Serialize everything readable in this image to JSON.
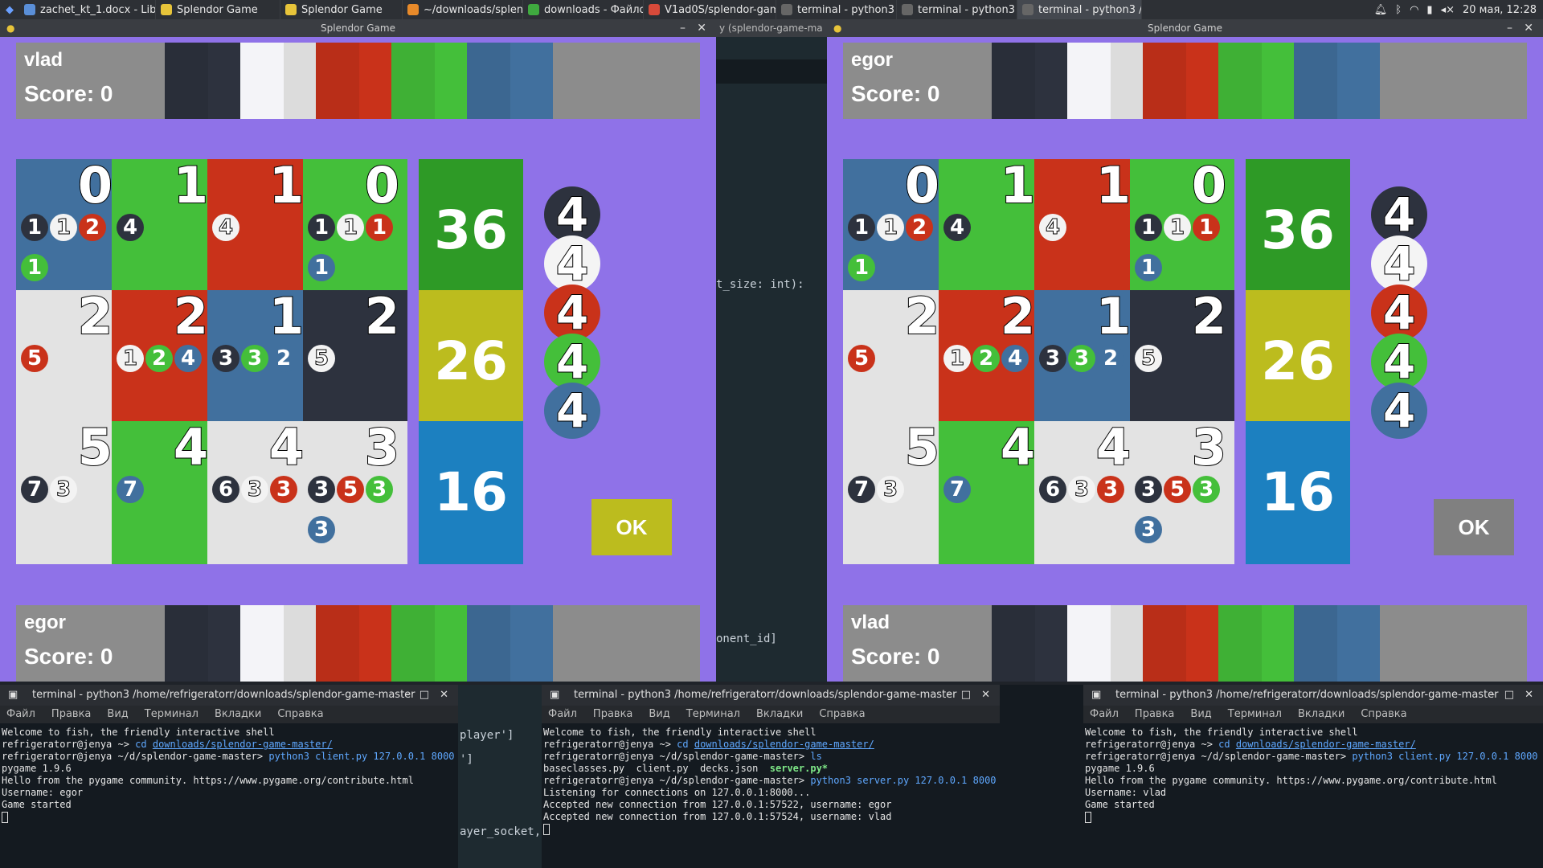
{
  "taskbar": {
    "tasks": [
      "zachet_kt_1.docx - LibreO...",
      "Splendor Game",
      "Splendor Game",
      "~/downloads/splendor-ga...",
      "downloads - Файловый м...",
      "V1ad0S/splendor-game - ...",
      "terminal - python3 /home/...",
      "terminal - python3 /home/...",
      "terminal - python3 /home/..."
    ],
    "clock": "20 мая, 12:28"
  },
  "left_window": {
    "title": "Splendor Game",
    "top_player": {
      "name": "vlad",
      "score": "Score: 0"
    },
    "bottom_player": {
      "name": "egor",
      "score": "Score: 0"
    },
    "ok_label": "OK",
    "ok_color": "#bcbc1e"
  },
  "right_window": {
    "title": "Splendor Game",
    "top_player": {
      "name": "egor",
      "score": "Score: 0"
    },
    "bottom_player": {
      "name": "vlad",
      "score": "Score: 0"
    },
    "ok_label": "OK",
    "ok_color": "#808080"
  },
  "board": {
    "cards": [
      {
        "color": "blue",
        "points": "0",
        "cost": [
          {
            "gem": "black",
            "n": "1"
          },
          {
            "gem": "white",
            "n": "1"
          },
          {
            "gem": "red",
            "n": "2"
          },
          {
            "gem": "green",
            "n": "1"
          }
        ]
      },
      {
        "color": "green",
        "points": "1",
        "cost": [
          {
            "gem": "black",
            "n": "4"
          }
        ]
      },
      {
        "color": "red",
        "points": "1",
        "cost": [
          {
            "gem": "white",
            "n": "4"
          }
        ]
      },
      {
        "color": "green",
        "points": "0",
        "cost": [
          {
            "gem": "black",
            "n": "1"
          },
          {
            "gem": "white",
            "n": "1"
          },
          {
            "gem": "red",
            "n": "1"
          },
          {
            "gem": "blue",
            "n": "1"
          }
        ]
      },
      {
        "color": "white",
        "points": "2",
        "cost": [
          {
            "gem": "red",
            "n": "5"
          }
        ]
      },
      {
        "color": "red",
        "points": "2",
        "cost": [
          {
            "gem": "white",
            "n": "1"
          },
          {
            "gem": "green",
            "n": "2"
          },
          {
            "gem": "blue",
            "n": "4"
          }
        ]
      },
      {
        "color": "blue",
        "points": "1",
        "cost": [
          {
            "gem": "black",
            "n": "3"
          },
          {
            "gem": "green",
            "n": "3"
          },
          {
            "gem": "blue",
            "n": "2"
          }
        ]
      },
      {
        "color": "black",
        "points": "2",
        "cost": [
          {
            "gem": "white",
            "n": "5"
          }
        ]
      },
      {
        "color": "white",
        "points": "5",
        "cost": [
          {
            "gem": "black",
            "n": "7"
          },
          {
            "gem": "white",
            "n": "3"
          }
        ]
      },
      {
        "color": "green",
        "points": "4",
        "cost": [
          {
            "gem": "blue",
            "n": "7"
          }
        ]
      },
      {
        "color": "white",
        "points": "4",
        "cost": [
          {
            "gem": "black",
            "n": "6"
          },
          {
            "gem": "white",
            "n": "3"
          },
          {
            "gem": "red",
            "n": "3"
          }
        ]
      },
      {
        "color": "white",
        "points": "3",
        "cost": [
          {
            "gem": "black",
            "n": "3"
          },
          {
            "gem": "red",
            "n": "5"
          },
          {
            "gem": "green",
            "n": "3"
          },
          {
            "gem": "blue",
            "n": "3"
          }
        ]
      }
    ],
    "decks": [
      {
        "count": "36",
        "color": "#2e9a26"
      },
      {
        "count": "26",
        "color": "#bcbc1e"
      },
      {
        "count": "16",
        "color": "#1c80c0"
      }
    ],
    "bank": [
      {
        "gem": "black",
        "n": "4"
      },
      {
        "gem": "white",
        "n": "4"
      },
      {
        "gem": "red",
        "n": "4"
      },
      {
        "gem": "green",
        "n": "4"
      },
      {
        "gem": "blue",
        "n": "4"
      }
    ]
  },
  "colors": {
    "black": "#2d323e",
    "white": "#e3e3e3",
    "red": "#c9321a",
    "green": "#44bf3a",
    "blue": "#41709e"
  },
  "editor": {
    "line1": "t_size: int):",
    "line2": "onent_id]",
    "line3": "player']",
    "line4": "']",
    "line5": "ayer_socket,"
  },
  "terminals": [
    {
      "title": "terminal - python3 /home/refrigeratorr/downloads/splendor-game-master",
      "menu": [
        "Файл",
        "Правка",
        "Вид",
        "Терминал",
        "Вкладки",
        "Справка"
      ],
      "lines": [
        {
          "t": "Welcome to fish, the friendly interactive shell"
        },
        {
          "p": "refrigeratorr@jenya ~> ",
          "c": "cd ",
          "u": "downloads/splendor-game-master/"
        },
        {
          "p": "refrigeratorr@jenya ~/d/splendor-game-master> ",
          "c": "python3 client.py 127.0.0.1 8000"
        },
        {
          "t": "pygame 1.9.6"
        },
        {
          "t": "Hello from the pygame community. https://www.pygame.org/contribute.html"
        },
        {
          "t": "Username: egor"
        },
        {
          "t": "Game started"
        }
      ]
    },
    {
      "title": "terminal - python3 /home/refrigeratorr/downloads/splendor-game-master",
      "menu": [
        "Файл",
        "Правка",
        "Вид",
        "Терминал",
        "Вкладки",
        "Справка"
      ],
      "lines": [
        {
          "t": "Welcome to fish, the friendly interactive shell"
        },
        {
          "p": "refrigeratorr@jenya ~> ",
          "c": "cd ",
          "u": "downloads/splendor-game-master/"
        },
        {
          "p": "refrigeratorr@jenya ~/d/splendor-game-master> ",
          "c": "ls"
        },
        {
          "t": "baseclasses.py  client.py  decks.json  ",
          "g": "server.py*"
        },
        {
          "p": "refrigeratorr@jenya ~/d/splendor-game-master> ",
          "c": "python3 server.py 127.0.0.1 8000"
        },
        {
          "t": "Listening for connections on 127.0.0.1:8000..."
        },
        {
          "t": "Accepted new connection from 127.0.0.1:57522, username: egor"
        },
        {
          "t": "Accepted new connection from 127.0.0.1:57524, username: vlad"
        }
      ]
    },
    {
      "title": "terminal - python3 /home/refrigeratorr/downloads/splendor-game-master",
      "menu": [
        "Файл",
        "Правка",
        "Вид",
        "Терминал",
        "Вкладки",
        "Справка"
      ],
      "lines": [
        {
          "t": "Welcome to fish, the friendly interactive shell"
        },
        {
          "p": "refrigeratorr@jenya ~> ",
          "c": "cd ",
          "u": "downloads/splendor-game-master/"
        },
        {
          "p": "refrigeratorr@jenya ~/d/splendor-game-master> ",
          "c": "python3 client.py 127.0.0.1 8000"
        },
        {
          "t": "pygame 1.9.6"
        },
        {
          "t": "Hello from the pygame community. https://www.pygame.org/contribute.html"
        },
        {
          "t": "Username: vlad"
        },
        {
          "t": "Game started"
        }
      ]
    }
  ]
}
